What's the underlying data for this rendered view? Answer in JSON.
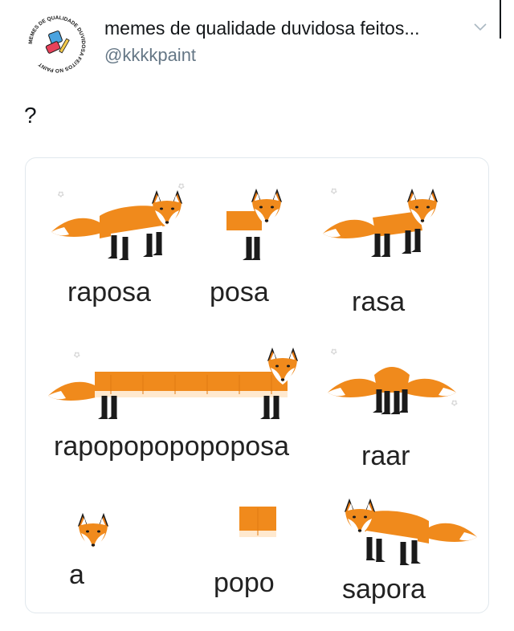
{
  "tweet": {
    "author_name": "memes de qualidade duvidosa feitos...",
    "author_handle": "@kkkkpaint",
    "text": "?",
    "avatar_ring_text": "MEMES DE QUALIDADE DUVIDOSA FEITOS NO PAINT"
  },
  "meme_card": {
    "labels": {
      "raposa": "raposa",
      "posa": "posa",
      "rasa": "rasa",
      "rapopopopopoposa": "rapopopopopoposa",
      "raar": "raar",
      "a": "a",
      "popo": "popo",
      "sapora": "sapora"
    }
  },
  "colors": {
    "fox_orange": "#f08a1c",
    "fox_white": "#ffffff",
    "fox_black": "#1a1a1a",
    "handle_gray": "#657786",
    "card_border": "#e1e8ed"
  }
}
